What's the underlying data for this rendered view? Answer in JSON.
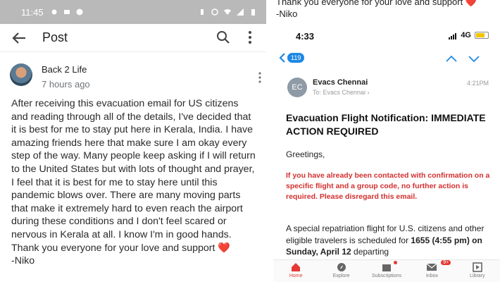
{
  "left": {
    "status": {
      "time": "11:45"
    },
    "appbar": {
      "title": "Post"
    },
    "author": {
      "name": "Back 2 Life",
      "time": "7 hours ago"
    },
    "post_body": "After receiving this evacuation email for US citizens and reading through all of the details, I've decided that it is best for me to stay put here in Kerala, India. I have amazing friends here that make sure I am okay every step of the way. Many people keep asking if I will return to the United States but with lots of thought and prayer, I feel that it is best for me to stay here until this pandemic blows over. There are many moving parts that make it extremely hard to even reach the airport during these conditions and I don't feel scared or nervous in Kerala at all. I know I'm in good hands. Thank you everyone for your love and support",
    "heart": "❤️",
    "signature": "-Niko"
  },
  "right": {
    "top_line1": "Thank you everyone for your love and support ❤️",
    "top_line2": "-Niko",
    "ios_time": "4:33",
    "network": "4G",
    "mail_count": "119",
    "sender": {
      "initials": "EC",
      "name": "Evacs Chennai",
      "to": "To: Evacs Chennai ›",
      "time": "4:21PM"
    },
    "subject": "Evacuation Flight Notification: IMMEDIATE ACTION REQUIRED",
    "greeting": "Greetings,",
    "notice": "If you have already been contacted with confirmation on a specific flight and a group code, no further action is required.  Please disregard this email.",
    "body_plain": "A special repatriation flight for U.S. citizens and other eligible travelers is scheduled for ",
    "body_bold1": "1655",
    "body_bold2": "(4:55 pm) on Sunday, April 12",
    "body_tail": " departing",
    "tabs": [
      {
        "label": "Home"
      },
      {
        "label": "Explore"
      },
      {
        "label": "Subscriptions"
      },
      {
        "label": "Inbox",
        "badge": "9+"
      },
      {
        "label": "Library"
      }
    ],
    "colors": {
      "accent": "#e53935",
      "link": "#1e88e5"
    }
  }
}
